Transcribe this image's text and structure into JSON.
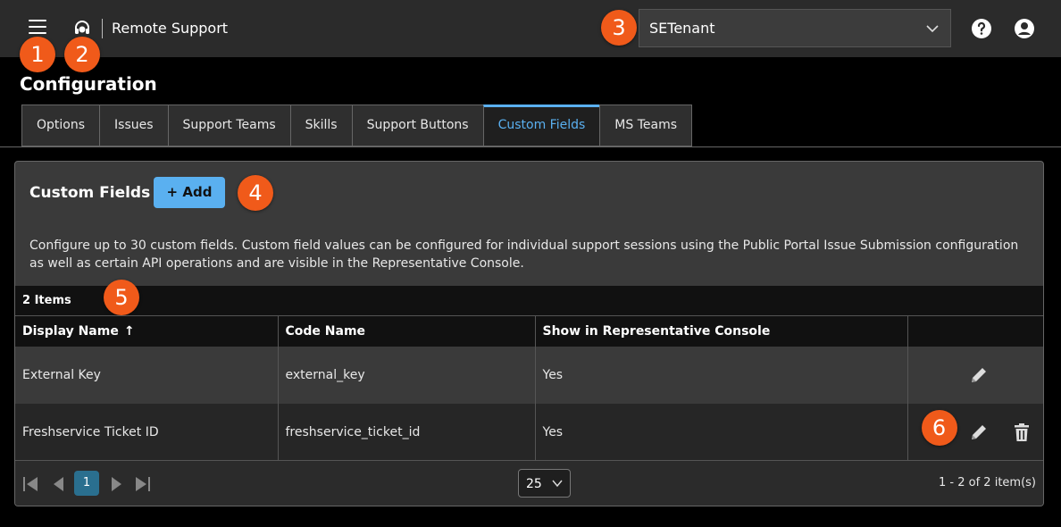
{
  "header": {
    "app_title": "Remote Support",
    "tenant_selected": "SETenant"
  },
  "badges": [
    "1",
    "2",
    "3",
    "4",
    "5",
    "6"
  ],
  "page": {
    "title": "Configuration"
  },
  "tabs": [
    {
      "label": "Options"
    },
    {
      "label": "Issues"
    },
    {
      "label": "Support Teams"
    },
    {
      "label": "Skills"
    },
    {
      "label": "Support Buttons"
    },
    {
      "label": "Custom Fields",
      "active": true
    },
    {
      "label": "MS Teams"
    }
  ],
  "panel": {
    "title": "Custom Fields",
    "add_label": "Add",
    "description": "Configure up to 30 custom fields. Custom field values can be configured for individual support sessions using the Public Portal Issue Submission configuration as well as certain API operations and are visible in the Representative Console.",
    "item_count": "2 Items"
  },
  "table": {
    "columns": [
      "Display Name",
      "Code Name",
      "Show in Representative Console",
      ""
    ],
    "sort_indicator": "↑",
    "rows": [
      {
        "display_name": "External Key",
        "code_name": "external_key",
        "show": "Yes"
      },
      {
        "display_name": "Freshservice Ticket ID",
        "code_name": "freshservice_ticket_id",
        "show": "Yes"
      }
    ]
  },
  "pager": {
    "current_page": "1",
    "page_size": "25",
    "range": "1 - 2 of 2 item(s)"
  },
  "colors": {
    "accent": "#5ab0f0",
    "badge": "#f05a1a",
    "topbar": "#2b2b2b",
    "panel": "#3a3a3a"
  }
}
